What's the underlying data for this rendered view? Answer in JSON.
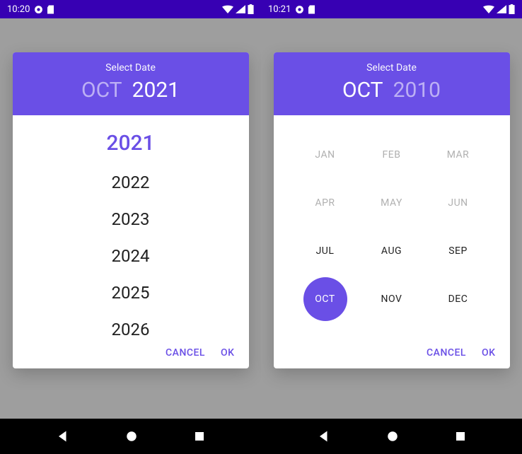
{
  "left": {
    "status": {
      "time": "10:20"
    },
    "dialog": {
      "title": "Select Date",
      "month": "OCT",
      "year": "2021",
      "years": [
        "2021",
        "2022",
        "2023",
        "2024",
        "2025",
        "2026"
      ],
      "selected_year_index": 0,
      "cancel": "CANCEL",
      "ok": "OK"
    }
  },
  "right": {
    "status": {
      "time": "10:21"
    },
    "dialog": {
      "title": "Select Date",
      "month": "OCT",
      "year": "2010",
      "months": [
        {
          "label": "JAN",
          "enabled": false
        },
        {
          "label": "FEB",
          "enabled": false
        },
        {
          "label": "MAR",
          "enabled": false
        },
        {
          "label": "APR",
          "enabled": false
        },
        {
          "label": "MAY",
          "enabled": false
        },
        {
          "label": "JUN",
          "enabled": false
        },
        {
          "label": "JUL",
          "enabled": true
        },
        {
          "label": "AUG",
          "enabled": true
        },
        {
          "label": "SEP",
          "enabled": true
        },
        {
          "label": "OCT",
          "enabled": true,
          "selected": true
        },
        {
          "label": "NOV",
          "enabled": true
        },
        {
          "label": "DEC",
          "enabled": true
        }
      ],
      "cancel": "CANCEL",
      "ok": "OK"
    }
  },
  "colors": {
    "primary": "#6a4fe6",
    "status": "#3700b3",
    "backdrop": "#9e9e9e"
  }
}
